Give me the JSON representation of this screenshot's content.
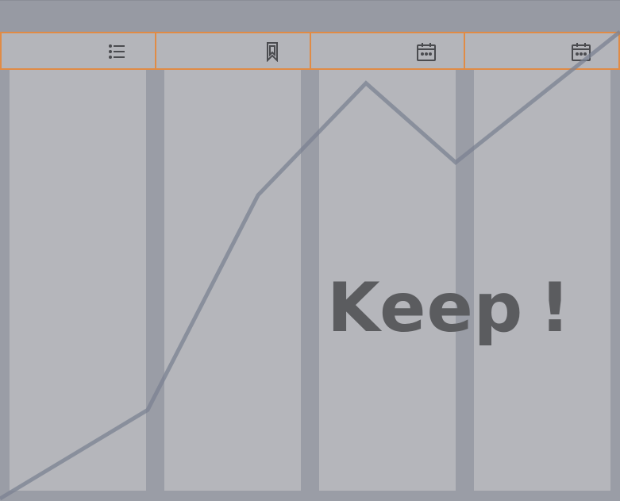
{
  "tabs": [
    {
      "icon": "list-icon"
    },
    {
      "icon": "bookmark-icon"
    },
    {
      "icon": "calendar-icon"
    },
    {
      "icon": "calendar-icon"
    }
  ],
  "banner": {
    "word": "Keep",
    "punct": "!"
  },
  "colors": {
    "accent_border": "#e08b45",
    "panel": "#b5b6bb",
    "background": "#9a9da6",
    "line": "#7b8292"
  },
  "trend": {
    "values": [
      0,
      0.19,
      0.65,
      0.89,
      0.72,
      1.0
    ]
  }
}
